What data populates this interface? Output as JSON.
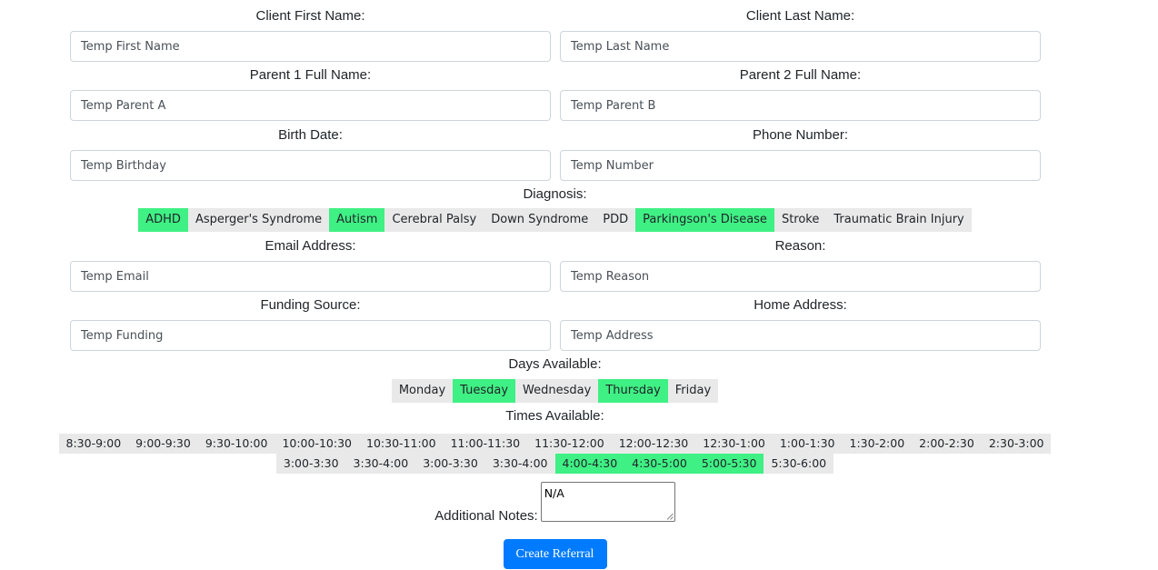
{
  "fields": {
    "first_name": {
      "label": "Client First Name:",
      "value": "Temp First Name"
    },
    "last_name": {
      "label": "Client Last Name:",
      "value": "Temp Last Name"
    },
    "parent1": {
      "label": "Parent 1 Full Name:",
      "value": "Temp Parent A"
    },
    "parent2": {
      "label": "Parent 2 Full Name:",
      "value": "Temp Parent B"
    },
    "birth_date": {
      "label": "Birth Date:",
      "value": "Temp Birthday"
    },
    "phone": {
      "label": "Phone Number:",
      "value": "Temp Number"
    },
    "email": {
      "label": "Email Address:",
      "value": "Temp Email"
    },
    "reason": {
      "label": "Reason:",
      "value": "Temp Reason"
    },
    "funding": {
      "label": "Funding Source:",
      "value": "Temp Funding"
    },
    "home_address": {
      "label": "Home Address:",
      "value": "Temp Address"
    }
  },
  "diagnosis": {
    "label": "Diagnosis:",
    "options": [
      {
        "label": "ADHD",
        "selected": true
      },
      {
        "label": "Asperger's Syndrome",
        "selected": false
      },
      {
        "label": "Autism",
        "selected": true
      },
      {
        "label": "Cerebral Palsy",
        "selected": false
      },
      {
        "label": "Down Syndrome",
        "selected": false
      },
      {
        "label": "PDD",
        "selected": false
      },
      {
        "label": "Parkingson's Disease",
        "selected": true
      },
      {
        "label": "Stroke",
        "selected": false
      },
      {
        "label": "Traumatic Brain Injury",
        "selected": false
      }
    ]
  },
  "days": {
    "label": "Days Available:",
    "options": [
      {
        "label": "Monday",
        "selected": false
      },
      {
        "label": "Tuesday",
        "selected": true
      },
      {
        "label": "Wednesday",
        "selected": false
      },
      {
        "label": "Thursday",
        "selected": true
      },
      {
        "label": "Friday",
        "selected": false
      }
    ]
  },
  "times": {
    "label": "Times Available:",
    "row1": [
      {
        "label": "8:30-9:00",
        "selected": false
      },
      {
        "label": "9:00-9:30",
        "selected": false
      },
      {
        "label": "9:30-10:00",
        "selected": false
      },
      {
        "label": "10:00-10:30",
        "selected": false
      },
      {
        "label": "10:30-11:00",
        "selected": false
      },
      {
        "label": "11:00-11:30",
        "selected": false
      },
      {
        "label": "11:30-12:00",
        "selected": false
      },
      {
        "label": "12:00-12:30",
        "selected": false
      },
      {
        "label": "12:30-1:00",
        "selected": false
      },
      {
        "label": "1:00-1:30",
        "selected": false
      },
      {
        "label": "1:30-2:00",
        "selected": false
      },
      {
        "label": "2:00-2:30",
        "selected": false
      },
      {
        "label": "2:30-3:00",
        "selected": false
      }
    ],
    "row2": [
      {
        "label": "3:00-3:30",
        "selected": false
      },
      {
        "label": "3:30-4:00",
        "selected": false
      },
      {
        "label": "3:00-3:30",
        "selected": false
      },
      {
        "label": "3:30-4:00",
        "selected": false
      },
      {
        "label": "4:00-4:30",
        "selected": true
      },
      {
        "label": "4:30-5:00",
        "selected": true
      },
      {
        "label": "5:00-5:30",
        "selected": true
      },
      {
        "label": "5:30-6:00",
        "selected": false
      }
    ]
  },
  "notes": {
    "label": "Additional Notes:",
    "value": "N/A"
  },
  "submit": {
    "label": "Create Referral"
  },
  "colors": {
    "selected": "#3ff084",
    "unselected": "#e9e9e9",
    "button": "#007bff"
  }
}
